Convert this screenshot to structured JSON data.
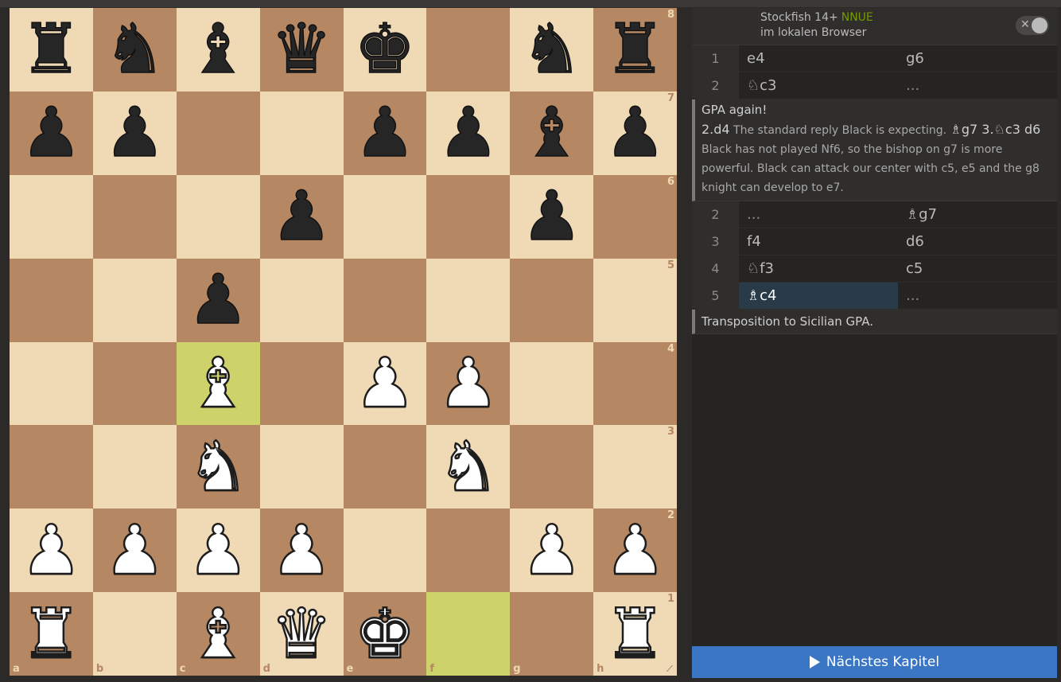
{
  "board": {
    "ranks": [
      "8",
      "7",
      "6",
      "5",
      "4",
      "3",
      "2",
      "1"
    ],
    "files": [
      "a",
      "b",
      "c",
      "d",
      "e",
      "f",
      "g",
      "h"
    ],
    "squares": [
      [
        "bR",
        "bN",
        "bB",
        "bQ",
        "bK",
        "",
        "bN",
        "bR"
      ],
      [
        "bP",
        "bP",
        "",
        "",
        "bP",
        "bP",
        "bB",
        "bP"
      ],
      [
        "",
        "",
        "",
        "bP",
        "",
        "",
        "bP",
        ""
      ],
      [
        "",
        "",
        "bP",
        "",
        "",
        "",
        "",
        ""
      ],
      [
        "",
        "",
        "wB",
        "",
        "wP",
        "wP",
        "",
        ""
      ],
      [
        "",
        "",
        "wN",
        "",
        "",
        "wN",
        "",
        ""
      ],
      [
        "wP",
        "wP",
        "wP",
        "wP",
        "",
        "",
        "wP",
        "wP"
      ],
      [
        "wR",
        "",
        "wB",
        "wQ",
        "wK",
        "",
        "",
        "wR"
      ]
    ],
    "highlights": [
      "c4",
      "f1"
    ],
    "colors": {
      "light": "#f0d9b5",
      "dark": "#b58863",
      "highlight": "#cdd26a"
    }
  },
  "engine": {
    "name": "Stockfish 14+",
    "tag": "NNUE",
    "sub": "im lokalen Browser",
    "toggle_icon": "close-x-icon"
  },
  "moves_top": [
    {
      "num": "1",
      "white": "e4",
      "black": "g6"
    },
    {
      "num": "2",
      "white": "♘c3",
      "black": "..."
    }
  ],
  "comment1": {
    "title": "GPA again!",
    "prefix_san": "2.d4",
    "text1": " The standard reply Black is expecting. ",
    "san2": "♗g7 3.♘c3 d6",
    "text2": " Black has not played Nf6, so the bishop on g7 is more powerful. Black can attack our center with c5, e5 and the g8 knight can develop to e7."
  },
  "moves_mid": [
    {
      "num": "2",
      "white": "...",
      "black": "♗g7"
    },
    {
      "num": "3",
      "white": "f4",
      "black": "d6"
    },
    {
      "num": "4",
      "white": "♘f3",
      "black": "c5"
    },
    {
      "num": "5",
      "white": "♗c4",
      "black": "..."
    }
  ],
  "comment2": {
    "text": "Transposition to Sicilian GPA."
  },
  "next_button": {
    "label": "Nächstes Kapitel",
    "icon": "play-icon"
  }
}
